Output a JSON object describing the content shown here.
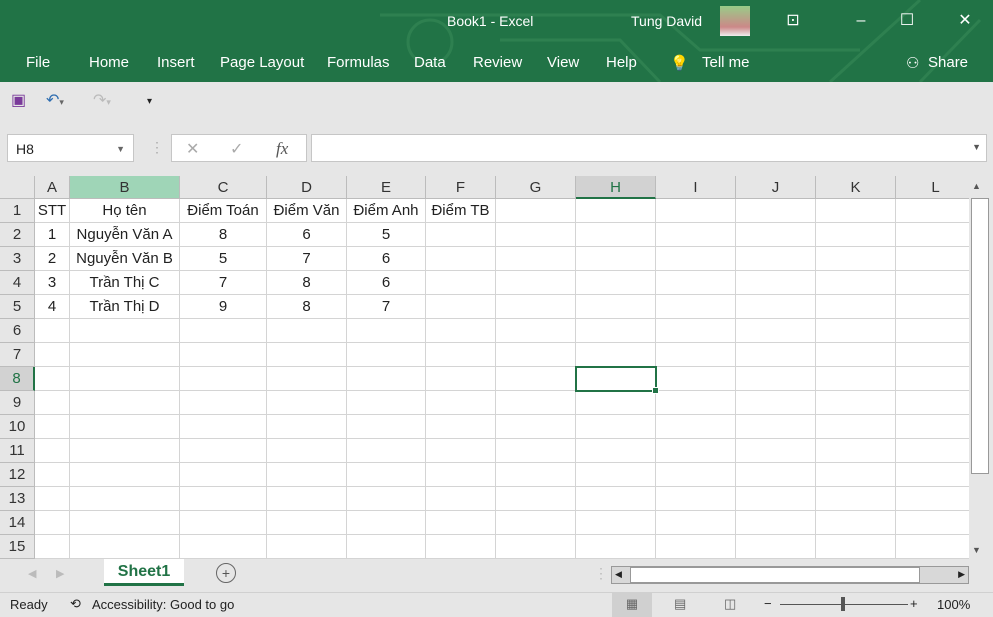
{
  "window": {
    "title": "Book1  -  Excel",
    "user": "Tung David"
  },
  "menu": [
    "File",
    "Home",
    "Insert",
    "Page Layout",
    "Formulas",
    "Data",
    "Review",
    "View",
    "Help",
    "Tell me"
  ],
  "share": "Share",
  "namebox": "H8",
  "fx": "fx",
  "columns": [
    "A",
    "B",
    "C",
    "D",
    "E",
    "F",
    "G",
    "H",
    "I",
    "J",
    "K",
    "L"
  ],
  "rows": [
    "1",
    "2",
    "3",
    "4",
    "5",
    "6",
    "7",
    "8",
    "9",
    "10",
    "11",
    "12",
    "13",
    "14",
    "15"
  ],
  "cells": [
    [
      "STT",
      "Họ tên",
      "Điểm Toán",
      "Điểm Văn",
      "Điểm Anh",
      "Điểm TB"
    ],
    [
      "1",
      "Nguyễn Văn A",
      "8",
      "6",
      "5",
      ""
    ],
    [
      "2",
      "Nguyễn Văn B",
      "5",
      "7",
      "6",
      ""
    ],
    [
      "3",
      "Trần Thị C",
      "7",
      "8",
      "6",
      ""
    ],
    [
      "4",
      "Trần Thị D",
      "9",
      "8",
      "7",
      ""
    ]
  ],
  "sheet_tab": "Sheet1",
  "status": {
    "ready": "Ready",
    "accessibility": "Accessibility: Good to go",
    "zoom": "100%"
  },
  "colors": {
    "accent": "#217346"
  }
}
